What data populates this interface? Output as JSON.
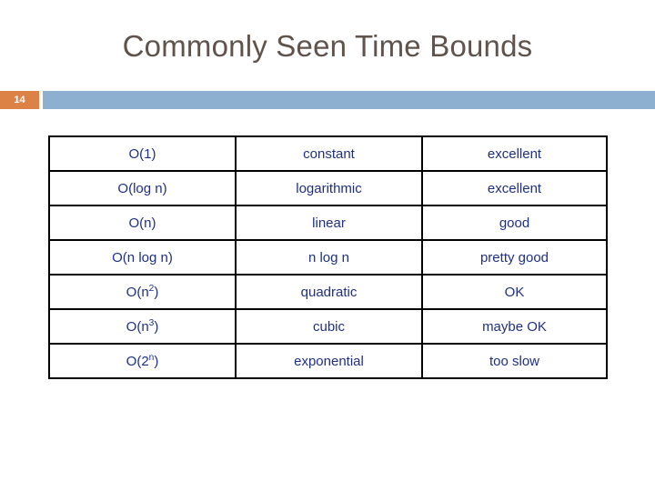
{
  "slide": {
    "title": "Commonly Seen Time Bounds",
    "number": "14",
    "accent_color": "#dd8247",
    "band_color": "#8db0d0",
    "title_color": "#5f534c",
    "table_text_color": "#1f3080"
  },
  "table": {
    "rows": [
      {
        "notation": "O(1)",
        "base": "O(1)",
        "exponent": "",
        "name": "constant",
        "rating": "excellent"
      },
      {
        "notation": "O(log n)",
        "base": "O(log n)",
        "exponent": "",
        "name": "logarithmic",
        "rating": "excellent"
      },
      {
        "notation": "O(n)",
        "base": "O(n)",
        "exponent": "",
        "name": "linear",
        "rating": "good"
      },
      {
        "notation": "O(n log n)",
        "base": "O(n log n)",
        "exponent": "",
        "name": "n log n",
        "rating": "pretty good"
      },
      {
        "notation": "O(n2)",
        "base": "O(n",
        "exponent": "2",
        "name": "quadratic",
        "rating": "OK"
      },
      {
        "notation": "O(n3)",
        "base": "O(n",
        "exponent": "3",
        "name": "cubic",
        "rating": "maybe OK"
      },
      {
        "notation": "O(2n)",
        "base": "O(2",
        "exponent": "n",
        "name": "exponential",
        "rating": "too slow"
      }
    ]
  }
}
